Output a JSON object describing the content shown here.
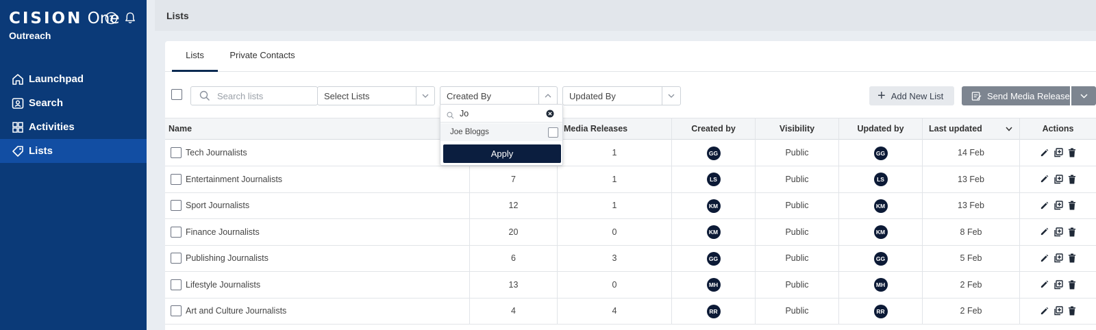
{
  "app": {
    "brand_strong": "CISION",
    "brand_light": " One",
    "product": "Outreach"
  },
  "sidebar": {
    "items": [
      {
        "label": "Launchpad",
        "icon": "home-icon"
      },
      {
        "label": "Search",
        "icon": "contacts-search-icon"
      },
      {
        "label": "Activities",
        "icon": "grid-icon"
      },
      {
        "label": "Lists",
        "icon": "tag-icon",
        "active": true
      }
    ]
  },
  "header": {
    "title": "Lists"
  },
  "tabs": [
    {
      "label": "Lists",
      "active": true
    },
    {
      "label": "Private Contacts",
      "active": false
    }
  ],
  "filters": {
    "search_placeholder": "Search lists",
    "select_lists": "Select Lists",
    "created_by": "Created By",
    "updated_by": "Updated By"
  },
  "actions": {
    "add_new_list": "Add New List",
    "send_media_release": "Send Media Release"
  },
  "dropdown": {
    "search_value": "Jo",
    "option": "Joe Bloggs",
    "apply": "Apply"
  },
  "table": {
    "columns": {
      "name": "Name",
      "media_releases": "Media Releases",
      "created_by": "Created by",
      "visibility": "Visibility",
      "updated_by": "Updated by",
      "last_updated": "Last updated",
      "actions": "Actions"
    },
    "rows": [
      {
        "name": "Tech Journalists",
        "contacts": "",
        "media_releases": "1",
        "created_by": "GG",
        "visibility": "Public",
        "updated_by": "GG",
        "last_updated": "14 Feb"
      },
      {
        "name": "Entertainment Journalists",
        "contacts": "7",
        "media_releases": "1",
        "created_by": "LS",
        "visibility": "Public",
        "updated_by": "LS",
        "last_updated": "13 Feb"
      },
      {
        "name": "Sport Journalists",
        "contacts": "12",
        "media_releases": "1",
        "created_by": "KM",
        "visibility": "Public",
        "updated_by": "KM",
        "last_updated": "13 Feb"
      },
      {
        "name": "Finance Journalists",
        "contacts": "20",
        "media_releases": "0",
        "created_by": "KM",
        "visibility": "Public",
        "updated_by": "KM",
        "last_updated": "8 Feb"
      },
      {
        "name": "Publishing Journalists",
        "contacts": "6",
        "media_releases": "3",
        "created_by": "GG",
        "visibility": "Public",
        "updated_by": "GG",
        "last_updated": "5 Feb"
      },
      {
        "name": "Lifestyle Journalists",
        "contacts": "13",
        "media_releases": "0",
        "created_by": "MH",
        "visibility": "Public",
        "updated_by": "MH",
        "last_updated": "2 Feb"
      },
      {
        "name": "Art and Culture Journalists",
        "contacts": "4",
        "media_releases": "4",
        "created_by": "RR",
        "visibility": "Public",
        "updated_by": "RR",
        "last_updated": "2 Feb"
      }
    ]
  }
}
